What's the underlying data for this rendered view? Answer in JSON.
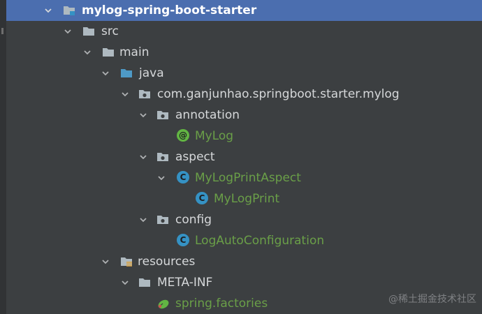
{
  "project_tree": {
    "root": {
      "label": "mylog-spring-boot-starter",
      "icon": "module-folder-icon",
      "expanded": true
    },
    "src": {
      "label": "src",
      "icon": "folder-icon",
      "expanded": true
    },
    "main": {
      "label": "main",
      "icon": "folder-icon",
      "expanded": true
    },
    "java": {
      "label": "java",
      "icon": "source-root-folder-icon",
      "expanded": true
    },
    "package": {
      "label": "com.ganjunhao.springboot.starter.mylog",
      "icon": "package-icon",
      "expanded": true
    },
    "annotation_pkg": {
      "label": "annotation",
      "icon": "package-icon",
      "expanded": true
    },
    "mylog": {
      "label": "MyLog",
      "icon": "annotation-icon",
      "badge": "@"
    },
    "aspect_pkg": {
      "label": "aspect",
      "icon": "package-icon",
      "expanded": true
    },
    "mylog_print_aspect": {
      "label": "MyLogPrintAspect",
      "icon": "class-icon",
      "badge": "C",
      "expanded": true
    },
    "mylog_print": {
      "label": "MyLogPrint",
      "icon": "class-icon",
      "badge": "C"
    },
    "config_pkg": {
      "label": "config",
      "icon": "package-icon",
      "expanded": true
    },
    "log_auto_configuration": {
      "label": "LogAutoConfiguration",
      "icon": "class-icon",
      "badge": "C"
    },
    "resources": {
      "label": "resources",
      "icon": "resources-root-folder-icon",
      "expanded": true
    },
    "meta_inf": {
      "label": "META-INF",
      "icon": "folder-icon",
      "expanded": true
    },
    "spring_factories": {
      "label": "spring.factories",
      "icon": "spring-leaf-icon"
    }
  },
  "watermark": "@稀土掘金技术社区",
  "colors": {
    "background": "#3c3f41",
    "selection": "#4b6eaf",
    "text": "#d6d8da",
    "green_text": "#6a9f48",
    "class_badge": "#3592c4",
    "annotation_badge": "#62b543",
    "folder": "#aeb9c0",
    "source_folder": "#4e9ac7"
  }
}
